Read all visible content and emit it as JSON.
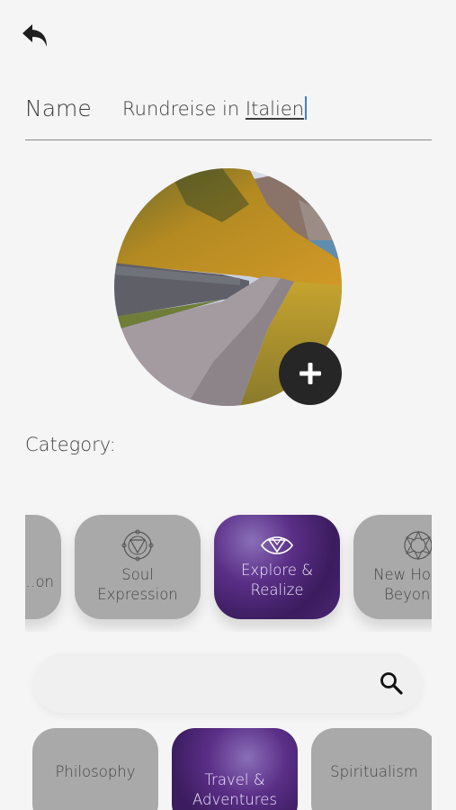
{
  "header": {
    "back_icon": "undo-arrow-icon"
  },
  "name_field": {
    "label": "Name",
    "value_plain": "Rundreise in ",
    "value_underlined": "Italien"
  },
  "cover": {
    "add_icon": "plus-icon"
  },
  "category": {
    "label": "Category:",
    "items": [
      {
        "label": "…on",
        "icon": "chakra-icon"
      },
      {
        "label": "Soul Expression",
        "icon": "throat-chakra-icon"
      },
      {
        "label": "Explore & Realize",
        "icon": "third-eye-icon"
      },
      {
        "label": "New Hori… Beyon…",
        "icon": "crown-chakra-icon"
      }
    ],
    "selected": "Explore & Realize"
  },
  "search": {
    "icon": "search-icon"
  },
  "subcategories": {
    "items": [
      {
        "label": "Philosophy"
      },
      {
        "label": "Travel & Adventures"
      },
      {
        "label": "Spiritualism"
      }
    ],
    "selected": "Travel & Adventures"
  },
  "colors": {
    "accent_purple": "#5a2f87",
    "tile_grey": "#a9a9a9",
    "dark_button": "#262626",
    "caret_blue": "#3f7fd9"
  }
}
